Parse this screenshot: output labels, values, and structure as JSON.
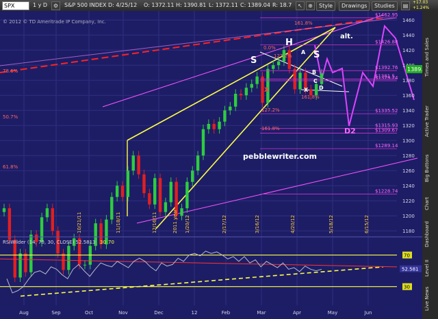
{
  "toolbar": {
    "symbol": "SPX",
    "period": "1 y D",
    "index_name": "S&P 500 INDEX",
    "date": "D: 4/25/12",
    "open": "O: 1372.11",
    "high": "H: 1390.81",
    "low": "L: 1372.11",
    "close": "C: 1389.04",
    "range": "R: 18.7",
    "style_label": "Style",
    "drawings_label": "Drawings",
    "studies_label": "Studies",
    "last_price": "1389.04",
    "change": "+17.03",
    "change_pct": "+1.24%"
  },
  "sidebar": {
    "tabs": [
      "Times and Sales",
      "Active Trader",
      "Big Buttons",
      "Chart",
      "Dashboard",
      "Level II",
      "Live News"
    ]
  },
  "chart_data": [
    {
      "type": "candlestick",
      "copyright": "© 2012 © TD Ameritrade IP Company, Inc.",
      "watermark": "pebblewriter.com",
      "x_tick_labels": [
        "Aug",
        "Sep",
        "Oct",
        "Nov",
        "Dec",
        "12",
        "Feb",
        "Mar",
        "Apr",
        "May",
        "Jun"
      ],
      "y_tick_labels": [
        "1460",
        "1440",
        "1420",
        "1400",
        "1380",
        "1360",
        "1340",
        "1320",
        "1300",
        "1280",
        "1260",
        "1240",
        "1220",
        "1200",
        "1180"
      ],
      "ylim": [
        1172,
        1472
      ],
      "last_price": "1389.04",
      "closes": [
        1210,
        1168,
        1118,
        1150,
        1125,
        1175,
        1165,
        1198,
        1210,
        1180,
        1150,
        1128,
        1160,
        1170,
        1135,
        1135,
        1160,
        1190,
        1162,
        1195,
        1225,
        1240,
        1225,
        1260,
        1280,
        1255,
        1230,
        1215,
        1250,
        1205,
        1218,
        1245,
        1200,
        1210,
        1245,
        1260,
        1280,
        1315,
        1322,
        1315,
        1325,
        1340,
        1345,
        1362,
        1360,
        1370,
        1375,
        1385,
        1350,
        1395,
        1400,
        1405,
        1420,
        1395,
        1368,
        1390,
        1368,
        1360,
        1375,
        1389
      ],
      "price_levels": [
        {
          "label": "$1462.95",
          "value": 1462.95
        },
        {
          "label": "$1426.88",
          "value": 1426.88
        },
        {
          "label": "$1392.76",
          "value": 1392.76
        },
        {
          "label": "$1379.24",
          "value": 1379.24
        },
        {
          "label": "$1381.5",
          "value": 1381.5
        },
        {
          "label": "$1335.52",
          "value": 1335.52
        },
        {
          "label": "$1315.93",
          "value": 1315.93
        },
        {
          "label": "$1309.67",
          "value": 1309.67
        },
        {
          "label": "$1289.14",
          "value": 1289.14
        },
        {
          "label": "$1228.74",
          "value": 1228.74
        }
      ],
      "fib_labels": [
        "161.8%",
        "127.2%",
        "0.0%",
        "78.6%",
        "50.7%",
        "61.8%",
        "127.2%",
        "161.8%",
        "161.8%"
      ],
      "pattern_labels": [
        "S",
        "H",
        "S",
        "alt.",
        "X",
        "A",
        "B",
        "C",
        "D",
        "X",
        "D2"
      ],
      "date_labels": [
        "10/21/11",
        "11/18/11",
        "12/16/11",
        "2011 year",
        "1/20/12",
        "2/17/12",
        "3/16/12",
        "4/20/12",
        "5/18/12",
        "6/15/12"
      ]
    },
    {
      "type": "line",
      "title": "RSIWilder (14, 70, 30, CLOSE) 52.5813",
      "title_high": "30",
      "title_low": "70",
      "y_tick_labels": [
        "70",
        "30"
      ],
      "level_70": 70,
      "level_30": 30,
      "current_value": "52.581",
      "ylim": [
        15,
        80
      ],
      "values": [
        40,
        22,
        25,
        30,
        40,
        48,
        50,
        46,
        55,
        52,
        45,
        40,
        52,
        58,
        50,
        43,
        52,
        60,
        57,
        55,
        62,
        58,
        54,
        62,
        66,
        62,
        55,
        50,
        60,
        56,
        58,
        66,
        62,
        70,
        72,
        69,
        75,
        72,
        74,
        70,
        65,
        68,
        62,
        68,
        60,
        64,
        55,
        62,
        58,
        54,
        60,
        52,
        54,
        49,
        56,
        52,
        50,
        52
      ]
    }
  ],
  "colors": {
    "background": "#1d1d66",
    "up_candle": "#2ecc40",
    "down_candle": "#e02020",
    "fib": "#ff6666",
    "yellow": "#ffff44",
    "magenta": "#dd44ff"
  }
}
